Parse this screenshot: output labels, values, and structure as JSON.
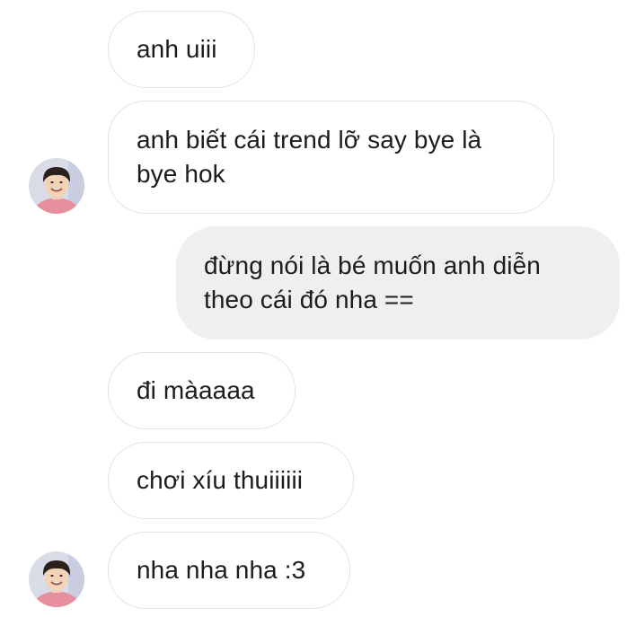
{
  "conversation": {
    "messages": [
      {
        "direction": "received",
        "text": "anh uiii"
      },
      {
        "direction": "received",
        "text": "anh biết cái trend lỡ say bye là bye hok"
      },
      {
        "direction": "sent",
        "text": "đừng nói là bé muốn anh diễn theo cái đó nha =="
      },
      {
        "direction": "received",
        "text": "đi màaaaa"
      },
      {
        "direction": "received",
        "text": "chơi xíu thuiiiiii"
      },
      {
        "direction": "received",
        "text": "nha nha nha :3"
      }
    ]
  },
  "colors": {
    "sent_bubble": "#efefef",
    "received_border": "#e4e4e4",
    "text": "#1c1c1c"
  },
  "icons": {
    "avatar": "contact-avatar-photo"
  }
}
